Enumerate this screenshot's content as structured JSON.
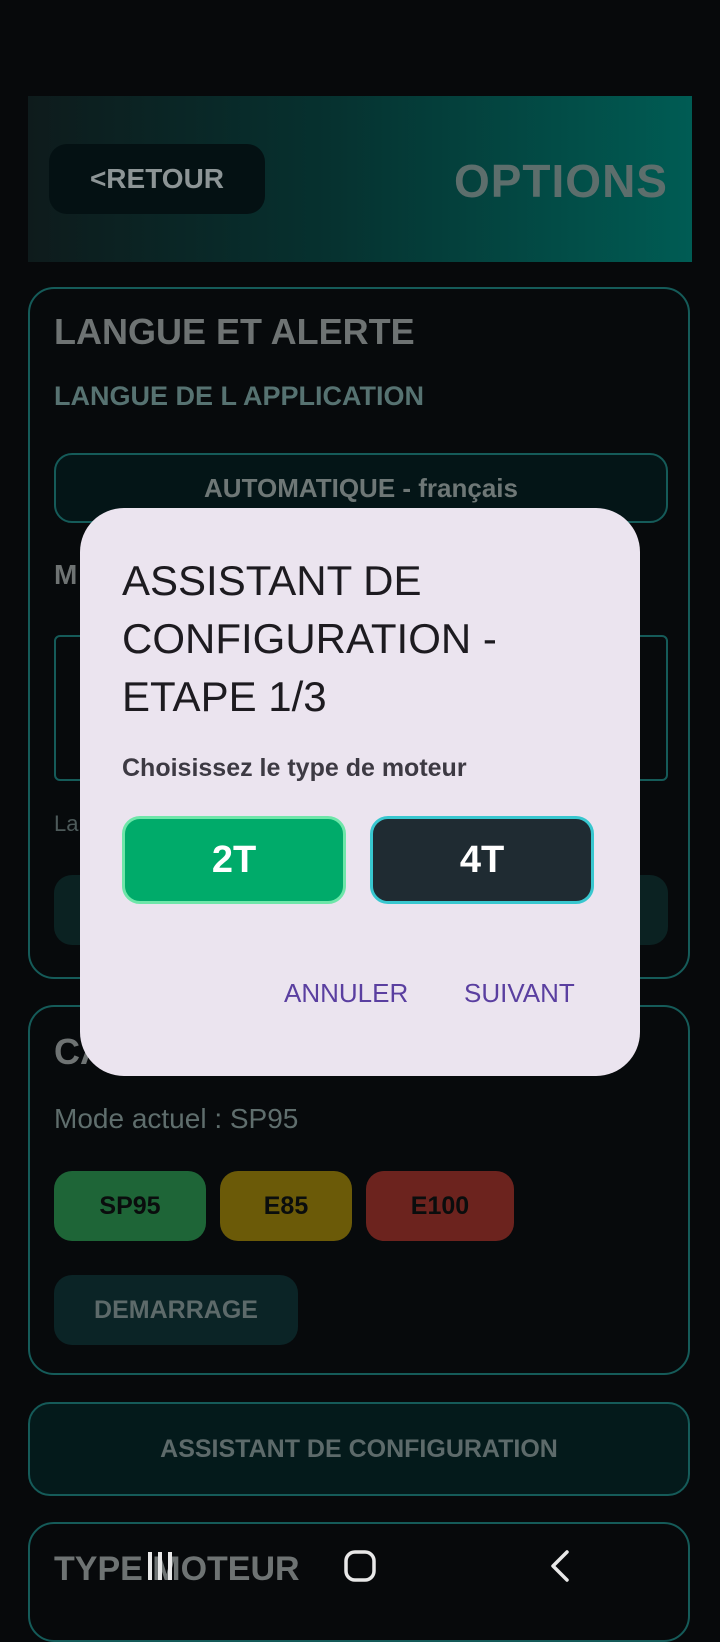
{
  "header": {
    "back_label": "<RETOUR",
    "title": "OPTIONS"
  },
  "language_card": {
    "title": "LANGUE ET ALERTE",
    "subtitle": "LANGUE DE L APPLICATION",
    "language_value": "AUTOMATIQUE - français",
    "partial_heading": "M",
    "partial_note": "La"
  },
  "fuel_card": {
    "title_partial": "CA",
    "mode_text": "Mode actuel : SP95",
    "buttons": [
      "SP95",
      "E85",
      "E100"
    ],
    "start_label": "DEMARRAGE"
  },
  "assistant_button": "ASSISTANT DE CONFIGURATION",
  "engine_card": {
    "title_partial": "TYPE MOTEUR"
  },
  "dialog": {
    "title": "ASSISTANT DE CONFIGURATION - ETAPE 1/3",
    "label": "Choisissez le type de moteur",
    "options": [
      "2T",
      "4T"
    ],
    "cancel": "ANNULER",
    "next": "SUIVANT"
  },
  "colors": {
    "accent_teal": "#155b59",
    "option_2t": "#00ab6a",
    "option_4t": "#1f2b32",
    "dialog_bg": "#ebe4ef",
    "dialog_action": "#5a3fa0"
  },
  "icons": [
    "recent-apps-icon",
    "home-icon",
    "back-icon"
  ]
}
